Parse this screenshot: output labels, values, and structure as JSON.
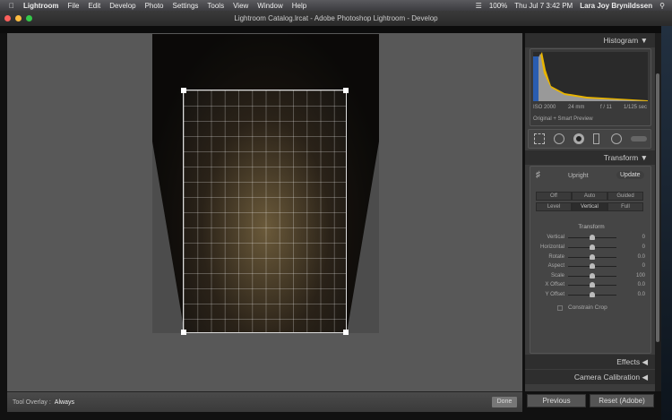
{
  "menubar": {
    "app": "Lightroom",
    "items": [
      "File",
      "Edit",
      "Develop",
      "Photo",
      "Settings",
      "Tools",
      "View",
      "Window",
      "Help"
    ],
    "battery": "100%",
    "datetime": "Thu Jul 7  3:42 PM",
    "user": "Lara Joy Brynildssen"
  },
  "window": {
    "title": "Lightroom Catalog.lrcat - Adobe Photoshop Lightroom - Develop"
  },
  "toolbar": {
    "label": "Tool Overlay :",
    "value": "Always",
    "done": "Done"
  },
  "histogram": {
    "title": "Histogram",
    "iso": "ISO 2000",
    "focal": "24 mm",
    "aperture": "f / 11",
    "shutter": "1/125 sec",
    "preview": "Original + Smart Preview"
  },
  "transform": {
    "title": "Transform",
    "upright_label": "Upright",
    "update": "Update",
    "modes": [
      "Off",
      "Auto",
      "Guided",
      "Level",
      "Vertical",
      "Full"
    ],
    "active_mode": "Vertical",
    "section": "Transform",
    "sliders": [
      {
        "label": "Vertical",
        "value": "0"
      },
      {
        "label": "Horizontal",
        "value": "0"
      },
      {
        "label": "Rotate",
        "value": "0.0"
      },
      {
        "label": "Aspect",
        "value": "0"
      },
      {
        "label": "Scale",
        "value": "100"
      },
      {
        "label": "X Offset",
        "value": "0.0"
      },
      {
        "label": "Y Offset",
        "value": "0.0"
      }
    ],
    "constrain": "Constrain Crop"
  },
  "panels": {
    "effects": "Effects",
    "calibration": "Camera Calibration"
  },
  "buttons": {
    "previous": "Previous",
    "reset": "Reset (Adobe)"
  }
}
